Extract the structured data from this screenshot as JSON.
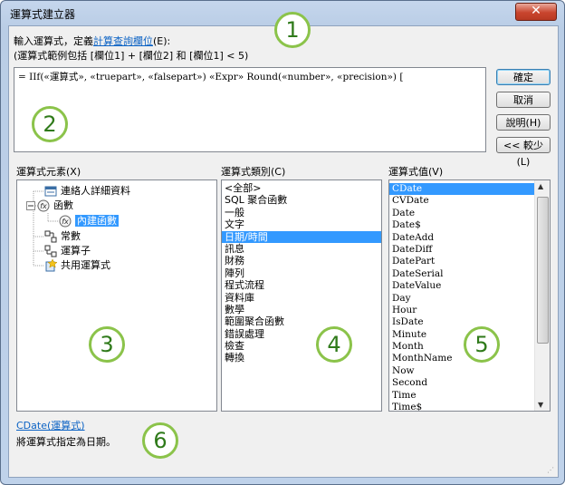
{
  "window": {
    "title": "運算式建立器",
    "close_symbol": "✕"
  },
  "instructions": {
    "line1_prefix": "輸入運算式，定義",
    "line1_link": "計算查詢欄位",
    "line1_suffix": "(E):",
    "line2": "(運算式範例包括 [欄位1] + [欄位2] 和 [欄位1] < 5)"
  },
  "expression": {
    "value": "= IIf(«運算式», «truepart», «falsepart») «Expr» Round(«number», «precision») ["
  },
  "buttons": {
    "ok": "確定",
    "cancel": "取消",
    "help": "說明(H)",
    "less": "<< 較少(L)"
  },
  "elements": {
    "label": "運算式元素(X)",
    "items": [
      "連絡人詳細資料",
      "函數",
      "內建函數",
      "常數",
      "運算子",
      "共用運算式"
    ]
  },
  "categories": {
    "label": "運算式類別(C)",
    "items": [
      "<全部>",
      "SQL 聚合函數",
      "一般",
      "文字",
      "日期/時間",
      "訊息",
      "財務",
      "陣列",
      "程式流程",
      "資料庫",
      "數學",
      "範圍聚合函數",
      "錯誤處理",
      "檢查",
      "轉換"
    ],
    "selected_index": 4
  },
  "values": {
    "label": "運算式值(V)",
    "items": [
      "CDate",
      "CVDate",
      "Date",
      "Date$",
      "DateAdd",
      "DateDiff",
      "DatePart",
      "DateSerial",
      "DateValue",
      "Day",
      "Hour",
      "IsDate",
      "Minute",
      "Month",
      "MonthName",
      "Now",
      "Second",
      "Time",
      "Time$"
    ],
    "selected_index": 0
  },
  "description": {
    "link": "CDate(運算式)",
    "text": "將運算式指定為日期。"
  },
  "callouts": [
    "1",
    "2",
    "3",
    "4",
    "5",
    "6"
  ],
  "colors": {
    "callout_border": "#8bc34a",
    "selection": "#3399ff",
    "link": "#0b62c4"
  }
}
